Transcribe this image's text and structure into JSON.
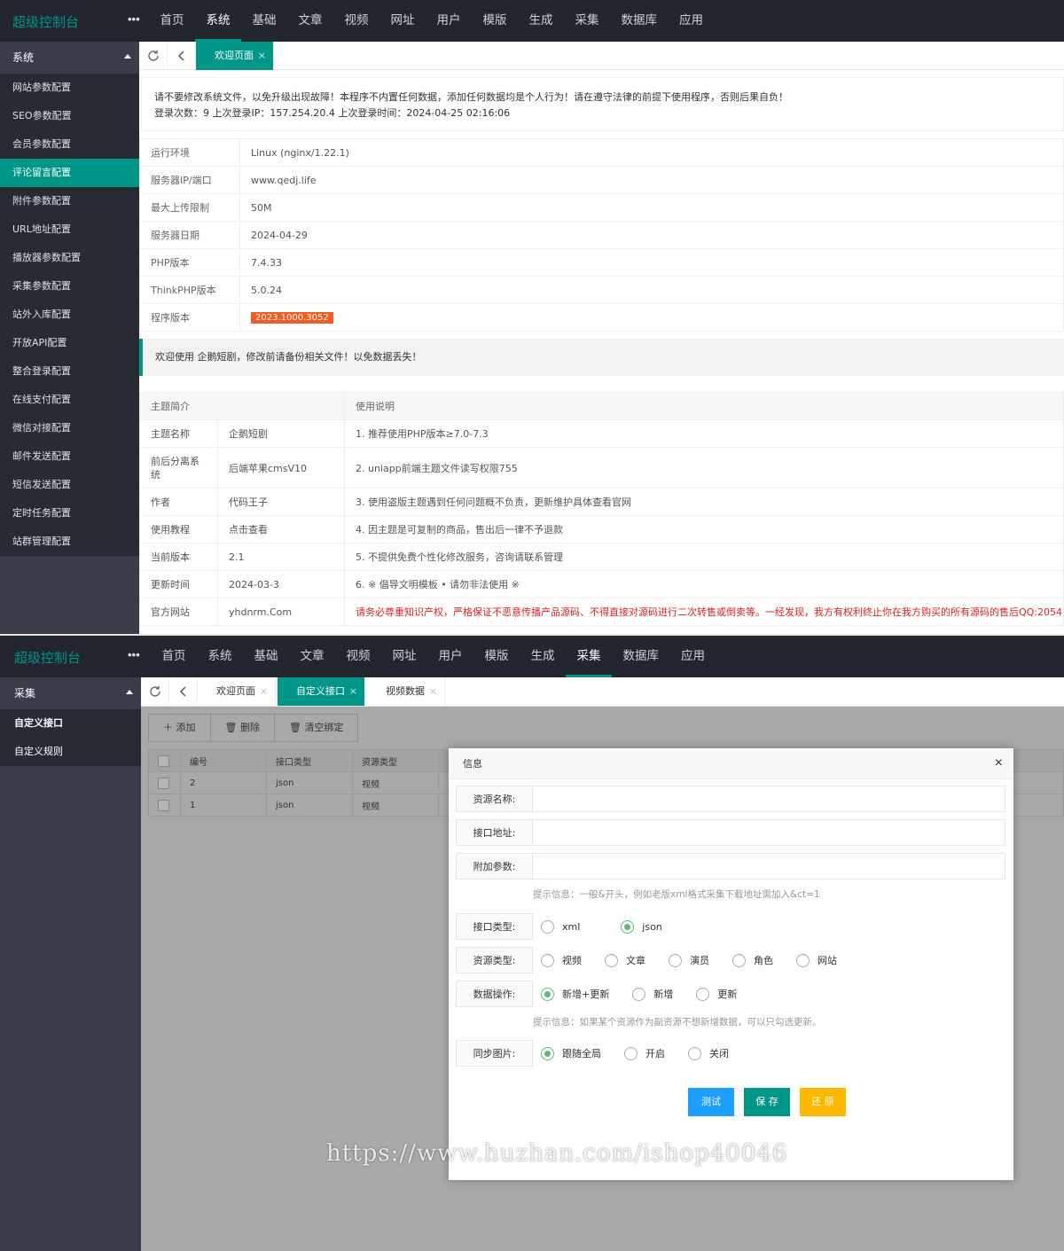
{
  "app": {
    "logo": "超级控制台",
    "more": "•••"
  },
  "nav": [
    "首页",
    "系统",
    "基础",
    "文章",
    "视频",
    "网址",
    "用户",
    "模版",
    "生成",
    "采集",
    "数据库",
    "应用"
  ],
  "shot1": {
    "sidebar_title": "系统",
    "sidebar_items": [
      "网站参数配置",
      "SEO参数配置",
      "会员参数配置",
      "评论留言配置",
      "附件参数配置",
      "URL地址配置",
      "播放器参数配置",
      "采集参数配置",
      "站外入库配置",
      "开放API配置",
      "整合登录配置",
      "在线支付配置",
      "微信对接配置",
      "邮件发送配置",
      "短信发送配置",
      "定时任务配置",
      "站群管理配置"
    ],
    "tab": "欢迎页面",
    "notice_line1": "请不要修改系统文件，以免升级出现故障！本程序不内置任何数据，添加任何数据均是个人行为！请在遵守法律的前提下使用程序，否则后果自负！",
    "notice_line2": "登录次数：9 上次登录IP：157.254.20.4 上次登录时间：2024-04-25 02:16:06",
    "server_info": [
      {
        "k": "运行环境",
        "v": "Linux (nginx/1.22.1)"
      },
      {
        "k": "服务器IP/端口",
        "v": "www.qedj.life"
      },
      {
        "k": "最大上传限制",
        "v": "50M"
      },
      {
        "k": "服务器日期",
        "v": "2024-04-29"
      },
      {
        "k": "PHP版本",
        "v": "7.4.33"
      },
      {
        "k": "ThinkPHP版本",
        "v": "5.0.24"
      },
      {
        "k": "程序版本",
        "v": "2023.1000.3052"
      }
    ],
    "welcome": "欢迎使用 企鹅短剧，修改前请备份相关文件！以免数据丢失！",
    "theme_header": [
      "主题简介",
      "使用说明"
    ],
    "theme_rows": [
      {
        "k": "主题名称",
        "v": "企鹅短剧",
        "note": "1. 推荐使用PHP版本≥7.0-7.3"
      },
      {
        "k": "前后分离系统",
        "v": "后端苹果cmsV10",
        "note": "2. uniapp前端主题文件读写权限755"
      },
      {
        "k": "作者",
        "v": "代码王子",
        "note": "3. 使用盗版主题遇到任何问题概不负责，更新维护具体查看官网"
      },
      {
        "k": "使用教程",
        "v": "点击查看",
        "note": "4. 因主题是可复制的商品，售出后一律不予退款"
      },
      {
        "k": "当前版本",
        "v": "2.1",
        "note": "5. 不提供免费个性化修改服务，咨询请联系管理"
      },
      {
        "k": "更新时间",
        "v": "2024-03-3",
        "note": "6. ※ 倡导文明模板 • 请勿非法使用 ※"
      },
      {
        "k": "官方网站",
        "v": "yhdnrm.Com",
        "note": "请务必尊重知识产权，严格保证不恶意传播产品源码、不得直接对源码进行二次转售或倒卖等。一经发现，我方有权利终止你在我方购买的所有源码的售后QQ:2054"
      }
    ],
    "colors": {
      "accent": "#009688",
      "badge": "#f25c22",
      "warn": "#e02020"
    }
  },
  "shot2": {
    "sidebar_title": "采集",
    "sidebar_items": [
      "自定义接口",
      "自定义规则"
    ],
    "tabs": [
      "欢迎页面",
      "自定义接口",
      "视频数据"
    ],
    "toolbar": {
      "add": "添加",
      "delete": "删除",
      "clear": "清空绑定"
    },
    "grid_header": [
      "编号",
      "接口类型",
      "资源类型"
    ],
    "grid_rows": [
      {
        "id": "2",
        "api": "json",
        "res": "视频"
      },
      {
        "id": "1",
        "api": "json",
        "res": "视频"
      }
    ],
    "dialog": {
      "title": "信息",
      "close": "×",
      "name_label": "资源名称:",
      "url_label": "接口地址:",
      "param_label": "附加参数:",
      "hint1": "提示信息：一般&开头，例如老版xml格式采集下载地址需加入&ct=1",
      "api_type_label": "接口类型:",
      "api_types": [
        "xml",
        "json"
      ],
      "res_type_label": "资源类型:",
      "res_types": [
        "视频",
        "文章",
        "演员",
        "角色",
        "网站"
      ],
      "op_label": "数据操作:",
      "ops": [
        "新增+更新",
        "新增",
        "更新"
      ],
      "hint2": "提示信息：如果某个资源作为副资源不想新增数据，可以只勾选更新。",
      "sync_label": "同步图片:",
      "syncs": [
        "跟随全局",
        "开启",
        "关闭"
      ],
      "btn_test": "测试",
      "btn_save": "保 存",
      "btn_reset": "还 原"
    },
    "watermark": "https://www.huzhan.com/ishop40046",
    "colors": {
      "test": "#1e9fff",
      "save": "#009688",
      "reset": "#ffb800",
      "radio": "#5fb878"
    }
  }
}
